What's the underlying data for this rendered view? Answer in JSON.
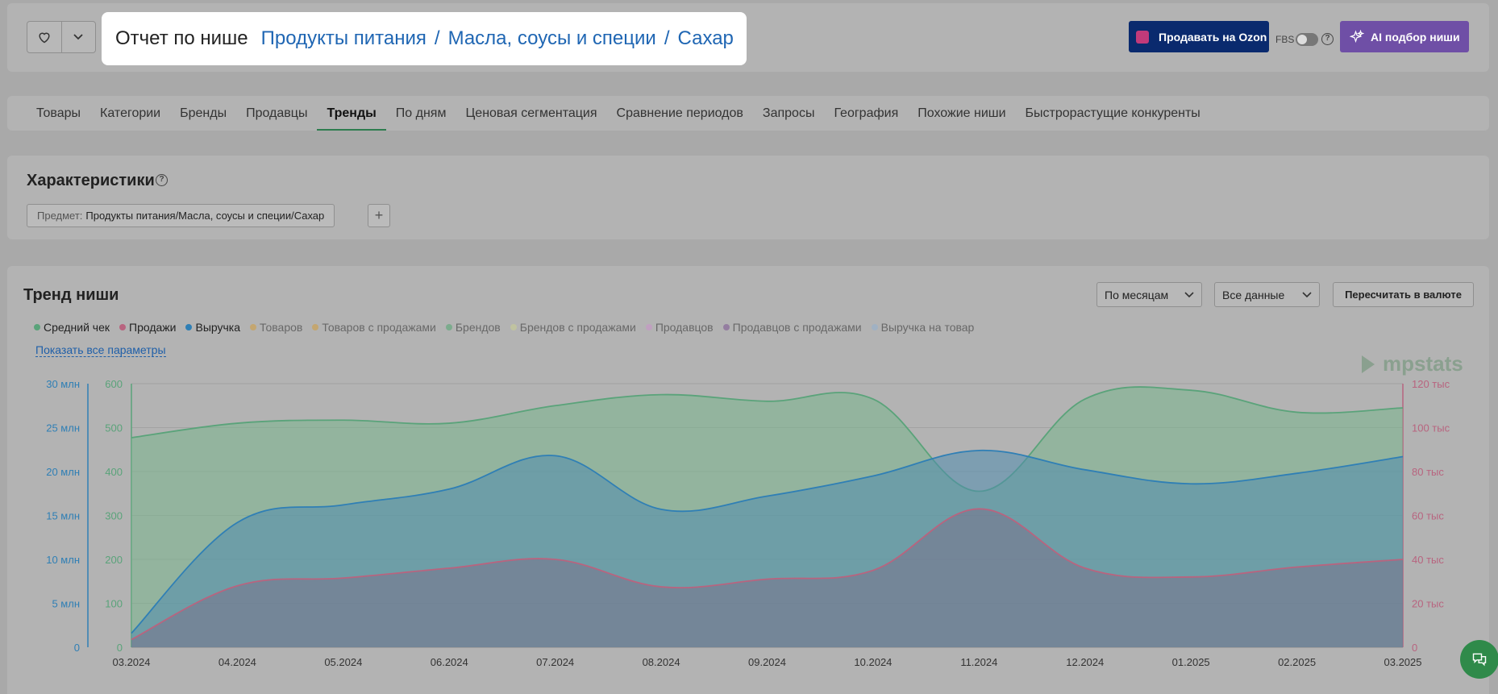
{
  "header": {
    "report_title": "Отчет по нише",
    "breadcrumbs": [
      "Продукты питания",
      "Масла, соусы и специи",
      "Сахар"
    ],
    "separator": "/",
    "ozon_button": "Продавать на Ozon",
    "fbs_label": "FBS",
    "help_glyph": "?",
    "ai_button": "AI подбор ниши"
  },
  "tabs": [
    {
      "label": "Товары",
      "active": false
    },
    {
      "label": "Категории",
      "active": false
    },
    {
      "label": "Бренды",
      "active": false
    },
    {
      "label": "Продавцы",
      "active": false
    },
    {
      "label": "Тренды",
      "active": true
    },
    {
      "label": "По дням",
      "active": false
    },
    {
      "label": "Ценовая сегментация",
      "active": false
    },
    {
      "label": "Сравнение периодов",
      "active": false
    },
    {
      "label": "Запросы",
      "active": false
    },
    {
      "label": "География",
      "active": false
    },
    {
      "label": "Похожие ниши",
      "active": false
    },
    {
      "label": "Быстрорастущие конкуренты",
      "active": false
    }
  ],
  "characteristics": {
    "title": "Характеристики",
    "chip_key": "Предмет:",
    "chip_value": "Продукты питания/Масла, соусы и специи/Сахар",
    "add_glyph": "+"
  },
  "trend": {
    "title": "Тренд ниши",
    "period_select": "По месяцам",
    "data_select": "Все данные",
    "currency_button": "Пересчитать в валюте",
    "show_all_link": "Показать все параметры",
    "watermark": "mpstats",
    "legend": [
      {
        "label": "Средний чек",
        "color": "#5aa37a",
        "active": true
      },
      {
        "label": "Продажи",
        "color": "#b8647f",
        "active": true
      },
      {
        "label": "Выручка",
        "color": "#2f7fb5",
        "active": true
      },
      {
        "label": "Товаров",
        "color": "#c9a25a",
        "active": false
      },
      {
        "label": "Товаров с продажами",
        "color": "#c9a25a",
        "active": false
      },
      {
        "label": "Брендов",
        "color": "#6aa880",
        "active": false
      },
      {
        "label": "Брендов с продажами",
        "color": "#c4c89a",
        "active": false
      },
      {
        "label": "Продавцов",
        "color": "#c49ac4",
        "active": false
      },
      {
        "label": "Продавцов с продажами",
        "color": "#8a6c9a",
        "active": false
      },
      {
        "label": "Выручка на товар",
        "color": "#9ab0c8",
        "active": false
      }
    ]
  },
  "chart_data": {
    "type": "area",
    "x": [
      "03.2024",
      "04.2024",
      "05.2024",
      "06.2024",
      "07.2024",
      "08.2024",
      "09.2024",
      "10.2024",
      "11.2024",
      "12.2024",
      "01.2025",
      "02.2025",
      "03.2025"
    ],
    "axes": {
      "left_revenue": {
        "ticks": [
          "0",
          "5 млн",
          "10 млн",
          "15 млн",
          "20 млн",
          "25 млн",
          "30 млн"
        ],
        "range": [
          0,
          30000000
        ],
        "color": "#2f7fb5"
      },
      "left_avg_check": {
        "ticks": [
          "0",
          "100",
          "200",
          "300",
          "400",
          "500",
          "600"
        ],
        "range": [
          0,
          600
        ],
        "color": "#5aa37a"
      },
      "right_sales": {
        "ticks": [
          "0",
          "20 тыс",
          "40 тыс",
          "60 тыс",
          "80 тыс",
          "100 тыс",
          "120 тыс"
        ],
        "range": [
          0,
          120000
        ],
        "color": "#b8647f"
      }
    },
    "series": [
      {
        "name": "Средний чек",
        "axis": "left_avg_check",
        "color": "#5aa37a",
        "values": [
          477,
          510,
          517,
          510,
          550,
          575,
          560,
          565,
          355,
          565,
          585,
          535,
          545
        ]
      },
      {
        "name": "Выручка",
        "axis": "left_revenue",
        "color": "#2f7fb5",
        "values": [
          1600000,
          14200000,
          16200000,
          18000000,
          21800000,
          15700000,
          17200000,
          19500000,
          22400000,
          20200000,
          18600000,
          19800000,
          21700000
        ]
      },
      {
        "name": "Продажи",
        "axis": "right_sales",
        "color": "#b8647f",
        "values": [
          3500,
          28000,
          31500,
          36000,
          40000,
          27500,
          31000,
          35000,
          63000,
          36000,
          32000,
          36500,
          40000
        ]
      }
    ],
    "grid": true
  }
}
